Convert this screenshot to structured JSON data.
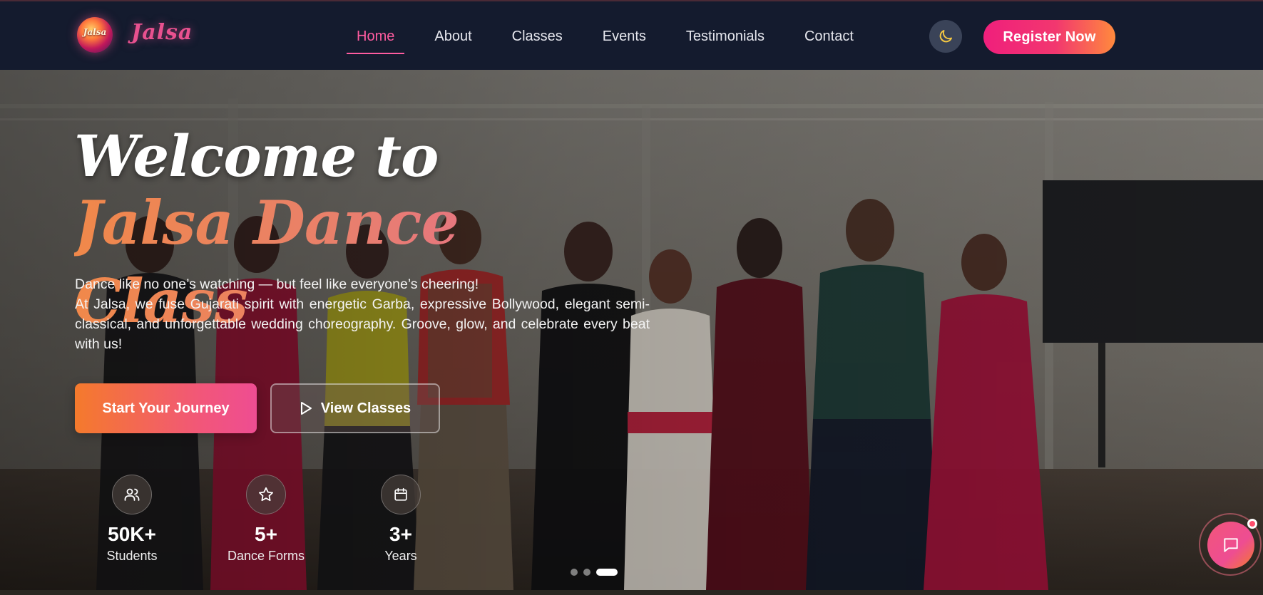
{
  "brand": {
    "logo_text": "Jalsa",
    "name": "Jalsa"
  },
  "nav": {
    "links": [
      {
        "label": "Home",
        "active": true
      },
      {
        "label": "About",
        "active": false
      },
      {
        "label": "Classes",
        "active": false
      },
      {
        "label": "Events",
        "active": false
      },
      {
        "label": "Testimonials",
        "active": false
      },
      {
        "label": "Contact",
        "active": false
      }
    ],
    "theme_toggle_icon": "moon-icon",
    "register_label": "Register Now"
  },
  "hero": {
    "welcome": "Welcome to",
    "title": "Jalsa Dance Class",
    "tagline": "Dance like no one’s watching — but feel like everyone’s cheering!",
    "description": "At Jalsa, we fuse Gujarati spirit with energetic Garba, expressive Bollywood, elegant semi-classical, and unforgettable wedding choreography. Groove, glow, and celebrate every beat with us!",
    "primary_cta": "Start Your Journey",
    "secondary_cta": "View Classes",
    "stats": [
      {
        "value": "50K+",
        "label": "Students",
        "icon": "users-icon"
      },
      {
        "value": "5+",
        "label": "Dance Forms",
        "icon": "star-icon"
      },
      {
        "value": "3+",
        "label": "Years",
        "icon": "calendar-icon"
      }
    ],
    "slides": {
      "count": 3,
      "active": 3
    }
  },
  "chat": {
    "icon": "chat-bubble-icon",
    "has_notification": true
  },
  "colors": {
    "nav_bg": "#141b2e",
    "accent_pink": "#ff5ca0",
    "accent_orange": "#f47a2c",
    "theme_toggle_bg": "#3a4358",
    "moon_icon": "#f5c842"
  }
}
